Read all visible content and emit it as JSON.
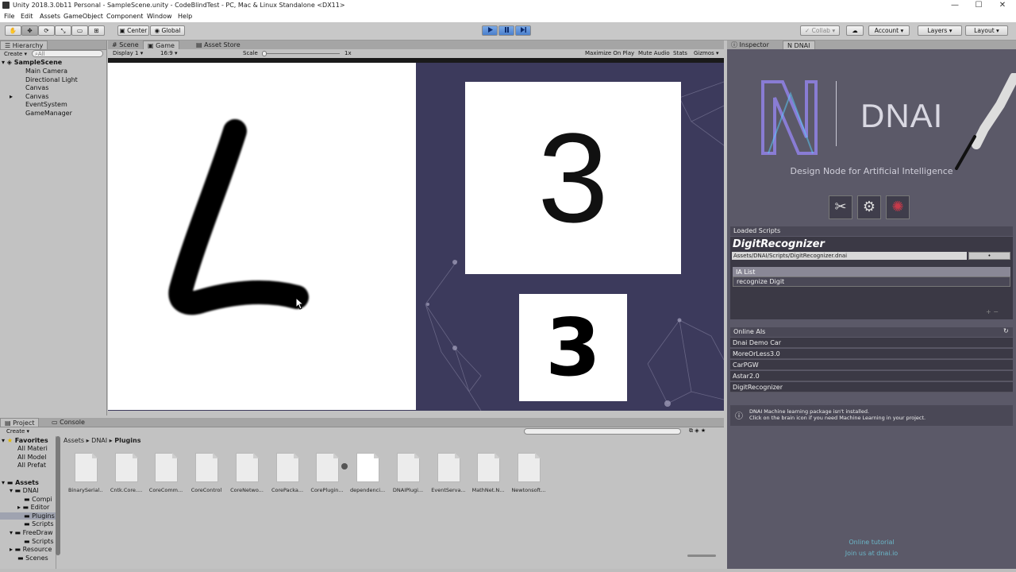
{
  "window": {
    "title": "Unity 2018.3.0b11 Personal - SampleScene.unity - CodeBlindTest - PC, Mac & Linux Standalone <DX11>",
    "controls": {
      "minimize": "—",
      "maximize": "☐",
      "close": "✕"
    }
  },
  "menu": [
    "File",
    "Edit",
    "Assets",
    "GameObject",
    "Component",
    "Window",
    "Help"
  ],
  "toolbar": {
    "pivot": "Center",
    "space": "Global",
    "play_icon": "play-icon",
    "pause_icon": "pause-icon",
    "step_icon": "step-icon",
    "collab": "Collab",
    "account": "Account",
    "layers": "Layers",
    "layout": "Layout"
  },
  "hierarchy": {
    "tab": "Hierarchy",
    "create": "Create",
    "search_placeholder": "All",
    "scene": "SampleScene",
    "items": [
      "Main Camera",
      "Directional Light",
      "Canvas",
      "Canvas",
      "EventSystem",
      "GameManager"
    ]
  },
  "center_tabs": [
    "Scene",
    "Game",
    "Asset Store"
  ],
  "game": {
    "display": "Display 1",
    "aspect": "16:9",
    "scale_label": "Scale",
    "scale_value": "1x",
    "options": [
      "Maximize On Play",
      "Mute Audio",
      "Stats",
      "Gizmos"
    ],
    "predicted_digit": "3",
    "thumbnail_digit": "3"
  },
  "inspector": {
    "tabs": [
      "Inspector",
      "DNAI"
    ],
    "logo_text": "DNAI",
    "tagline": "Design Node for Artificial Intelligence",
    "loaded_scripts_label": "Loaded Scripts",
    "script_name": "DigitRecognizer",
    "script_path": "Assets/DNAI/Scripts/DigitRecognizer.dnai",
    "ia_list_label": "IA List",
    "ia_items": [
      "recognize Digit"
    ],
    "online_label": "Online AIs",
    "online_items": [
      "Dnai Demo Car",
      "MoreOrLess3.0",
      "CarPGW",
      "Astar2.0",
      "DigitRecognizer"
    ],
    "warning_line1": "DNAI Machine learning package isn't installed.",
    "warning_line2": "Click on the brain icon if you need Machine Learning in your project.",
    "footer_line1": "Online tutorial",
    "footer_line2": "Join us at dnai.io",
    "accent_color": "#8e7fe0"
  },
  "project": {
    "tabs": [
      "Project",
      "Console"
    ],
    "create": "Create",
    "favorites_label": "Favorites",
    "favorites": [
      "All Materi",
      "All Model",
      "All Prefat"
    ],
    "assets_label": "Assets",
    "tree": [
      "DNAI",
      "Compi",
      "Editor",
      "Plugins",
      "Scripts",
      "FreeDraw",
      "Scripts",
      "Resource",
      "Scenes"
    ],
    "breadcrumb": [
      "Assets",
      "DNAI",
      "Plugins"
    ],
    "files": [
      "BinarySerial...",
      "Cntk.Core....",
      "CoreComm...",
      "CoreControl",
      "CoreNetwo...",
      "CorePacka...",
      "CorePlugin...",
      "dependenci...",
      "DNAIPlugi...",
      "EventServa...",
      "MathNet.N...",
      "Newtonsoft..."
    ]
  }
}
